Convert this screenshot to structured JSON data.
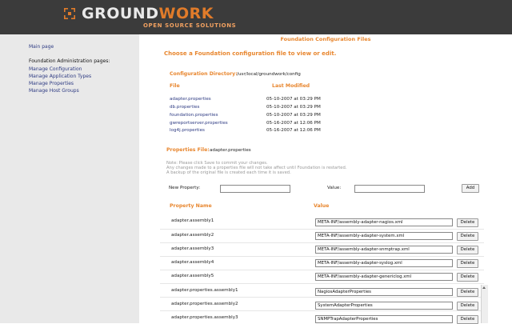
{
  "header": {
    "logo_primary": "GROUND",
    "logo_accent": "WORK",
    "logo_sub": "OPEN SOURCE SOLUTIONS",
    "accent_color": "#e07b2a",
    "bg_color": "#3b3b3b"
  },
  "sidebar": {
    "main_page": "Main page",
    "section_label": "Foundation Administration pages:",
    "links": [
      "Manage Configuration",
      "Manage Application Types",
      "Manage Properties",
      "Manage Host Groups"
    ]
  },
  "main": {
    "title": "Foundation Configuration Files",
    "prompt": "Choose a Foundation configuration file to view or edit.",
    "config_dir_label": "Configuration Directory:",
    "config_dir_value": "/usr/local/groundwork/config",
    "file_header": "File",
    "modified_header": "Last Modified",
    "files": [
      {
        "name": "adapter.properties",
        "modified": "05-10-2007 at 03:29 PM"
      },
      {
        "name": "db.properties",
        "modified": "05-10-2007 at 03:29 PM"
      },
      {
        "name": "foundation.properties",
        "modified": "05-10-2007 at 03:29 PM"
      },
      {
        "name": "gwreportserver.properties",
        "modified": "05-16-2007 at 12:06 PM"
      },
      {
        "name": "log4j.properties",
        "modified": "05-16-2007 at 12:06 PM"
      }
    ],
    "properties_file_label": "Properties File:",
    "properties_file_value": "adapter.properties",
    "notes": [
      "Note: Please click Save to commit your changes.",
      "Any changes made to a properties file will not take affect until Foundation is restarted.",
      "A backup of the original file is created each time it is saved."
    ],
    "new_property_label": "New Property:",
    "new_property_value": "",
    "value_label": "Value:",
    "value_value": "",
    "add_label": "Add",
    "prop_name_header": "Property Name",
    "value_header": "Value",
    "delete_label": "Delete",
    "properties": [
      {
        "name": "adapter.assembly1",
        "value": "META-INF/assembly-adapter-nagios.xml"
      },
      {
        "name": "adapter.assembly2",
        "value": "META-INF/assembly-adapter-system.xml"
      },
      {
        "name": "adapter.assembly3",
        "value": "META-INF/assembly-adapter-snmptrap.xml"
      },
      {
        "name": "adapter.assembly4",
        "value": "META-INF/assembly-adapter-syslog.xml"
      },
      {
        "name": "adapter.assembly5",
        "value": "META-INF/assembly-adapter-genericlog.xml"
      },
      {
        "name": "adapter.properties.assembly1",
        "value": "NagiosAdapterProperties"
      },
      {
        "name": "adapter.properties.assembly2",
        "value": "SystemAdapterProperties"
      },
      {
        "name": "adapter.properties.assembly3",
        "value": "SNMPTrapAdapterProperties"
      }
    ]
  }
}
